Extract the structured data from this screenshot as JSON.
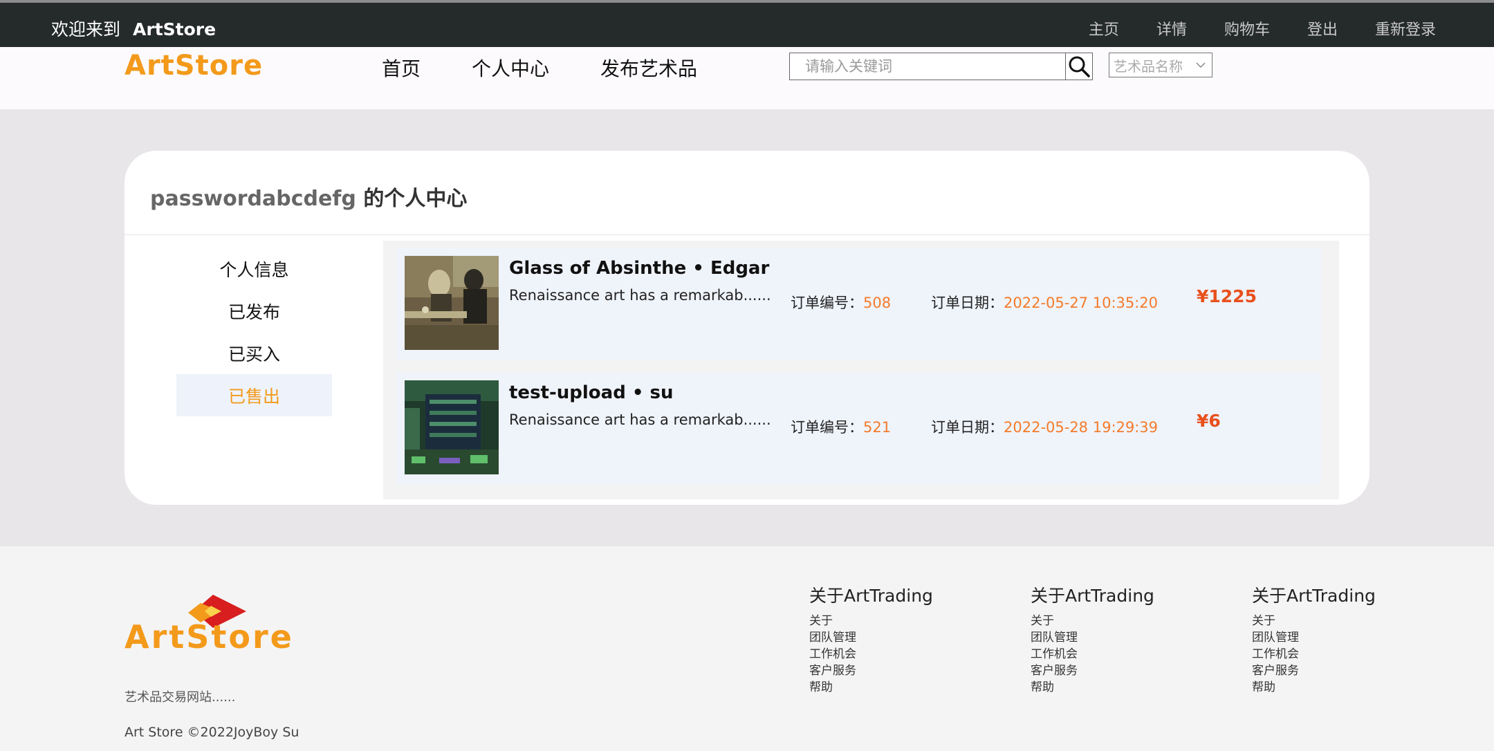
{
  "topbar": {
    "welcome": "欢迎来到",
    "brand": "ArtStore",
    "nav": [
      "主页",
      "详情",
      "购物车",
      "登出",
      "重新登录"
    ]
  },
  "header": {
    "logo": "ArtStore",
    "nav": [
      "首页",
      "个人中心",
      "发布艺术品"
    ],
    "search_placeholder": "请输入关键词",
    "select_value": "艺术品名称"
  },
  "profile": {
    "username": "passwordabcdefg",
    "title_suffix": " 的个人中心",
    "menu": [
      "个人信息",
      "已发布",
      "已买入",
      "已售出"
    ],
    "active_menu": "已售出"
  },
  "orders": [
    {
      "title": "Glass of Absinthe • Edgar",
      "desc": "Renaissance art has a remarkab......",
      "order_no_label": "订单编号：",
      "order_no": "508",
      "date_label": "订单日期：",
      "date": "2022-05-27 10:35:20",
      "price": "¥1225"
    },
    {
      "title": "test-upload • su",
      "desc": "Renaissance art has a remarkab......",
      "order_no_label": "订单编号：",
      "order_no": "521",
      "date_label": "订单日期：",
      "date": "2022-05-28 19:29:39",
      "price": "¥6"
    }
  ],
  "footer": {
    "logo": "ArtStore",
    "tagline": "艺术品交易网站......",
    "copyright": "Art Store ©2022JoyBoy Su",
    "columns": [
      {
        "heading": "关于ArtTrading",
        "links": [
          "关于",
          "团队管理",
          "工作机会",
          "客户服务",
          "帮助"
        ]
      },
      {
        "heading": "关于ArtTrading",
        "links": [
          "关于",
          "团队管理",
          "工作机会",
          "客户服务",
          "帮助"
        ]
      },
      {
        "heading": "关于ArtTrading",
        "links": [
          "关于",
          "团队管理",
          "工作机会",
          "客户服务",
          "帮助"
        ]
      }
    ]
  },
  "colors": {
    "accent": "#f39a1b",
    "price": "#e8501c",
    "topbar": "#252a2b"
  }
}
